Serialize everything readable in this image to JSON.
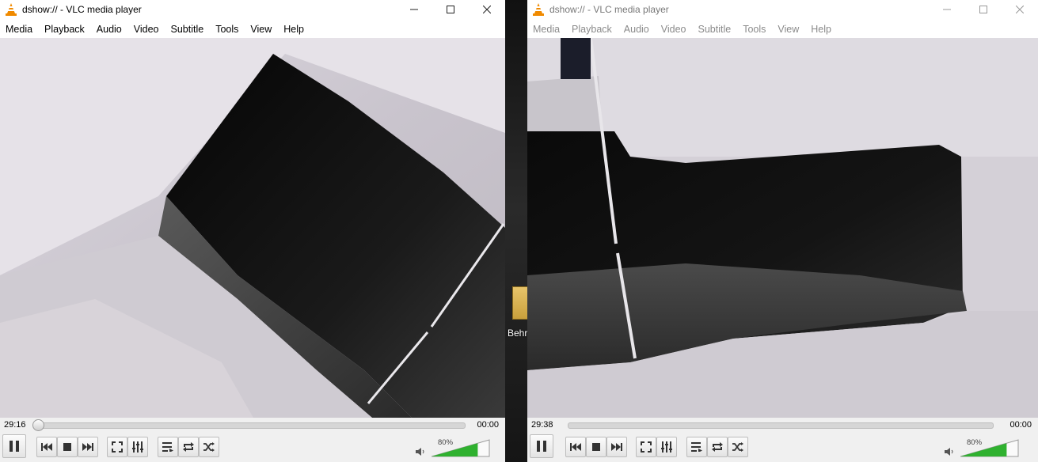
{
  "windows": [
    {
      "title": "dshow:// - VLC media player",
      "menu": [
        "Media",
        "Playback",
        "Audio",
        "Video",
        "Subtitle",
        "Tools",
        "View",
        "Help"
      ],
      "time_elapsed": "29:16",
      "time_total": "00:00",
      "volume_label": "80%",
      "volume_fraction": 0.8,
      "seek_fraction": 0.0,
      "active": true
    },
    {
      "title": "dshow:// - VLC media player",
      "menu": [
        "Media",
        "Playback",
        "Audio",
        "Video",
        "Subtitle",
        "Tools",
        "View",
        "Help"
      ],
      "time_elapsed": "29:38",
      "time_total": "00:00",
      "volume_label": "80%",
      "volume_fraction": 0.8,
      "seek_fraction": 0.0,
      "active": false
    }
  ],
  "desktop": {
    "icon_label": "Behr"
  },
  "colors": {
    "volume_fill": "#2fb12f",
    "vlc_orange": "#f08a00"
  }
}
